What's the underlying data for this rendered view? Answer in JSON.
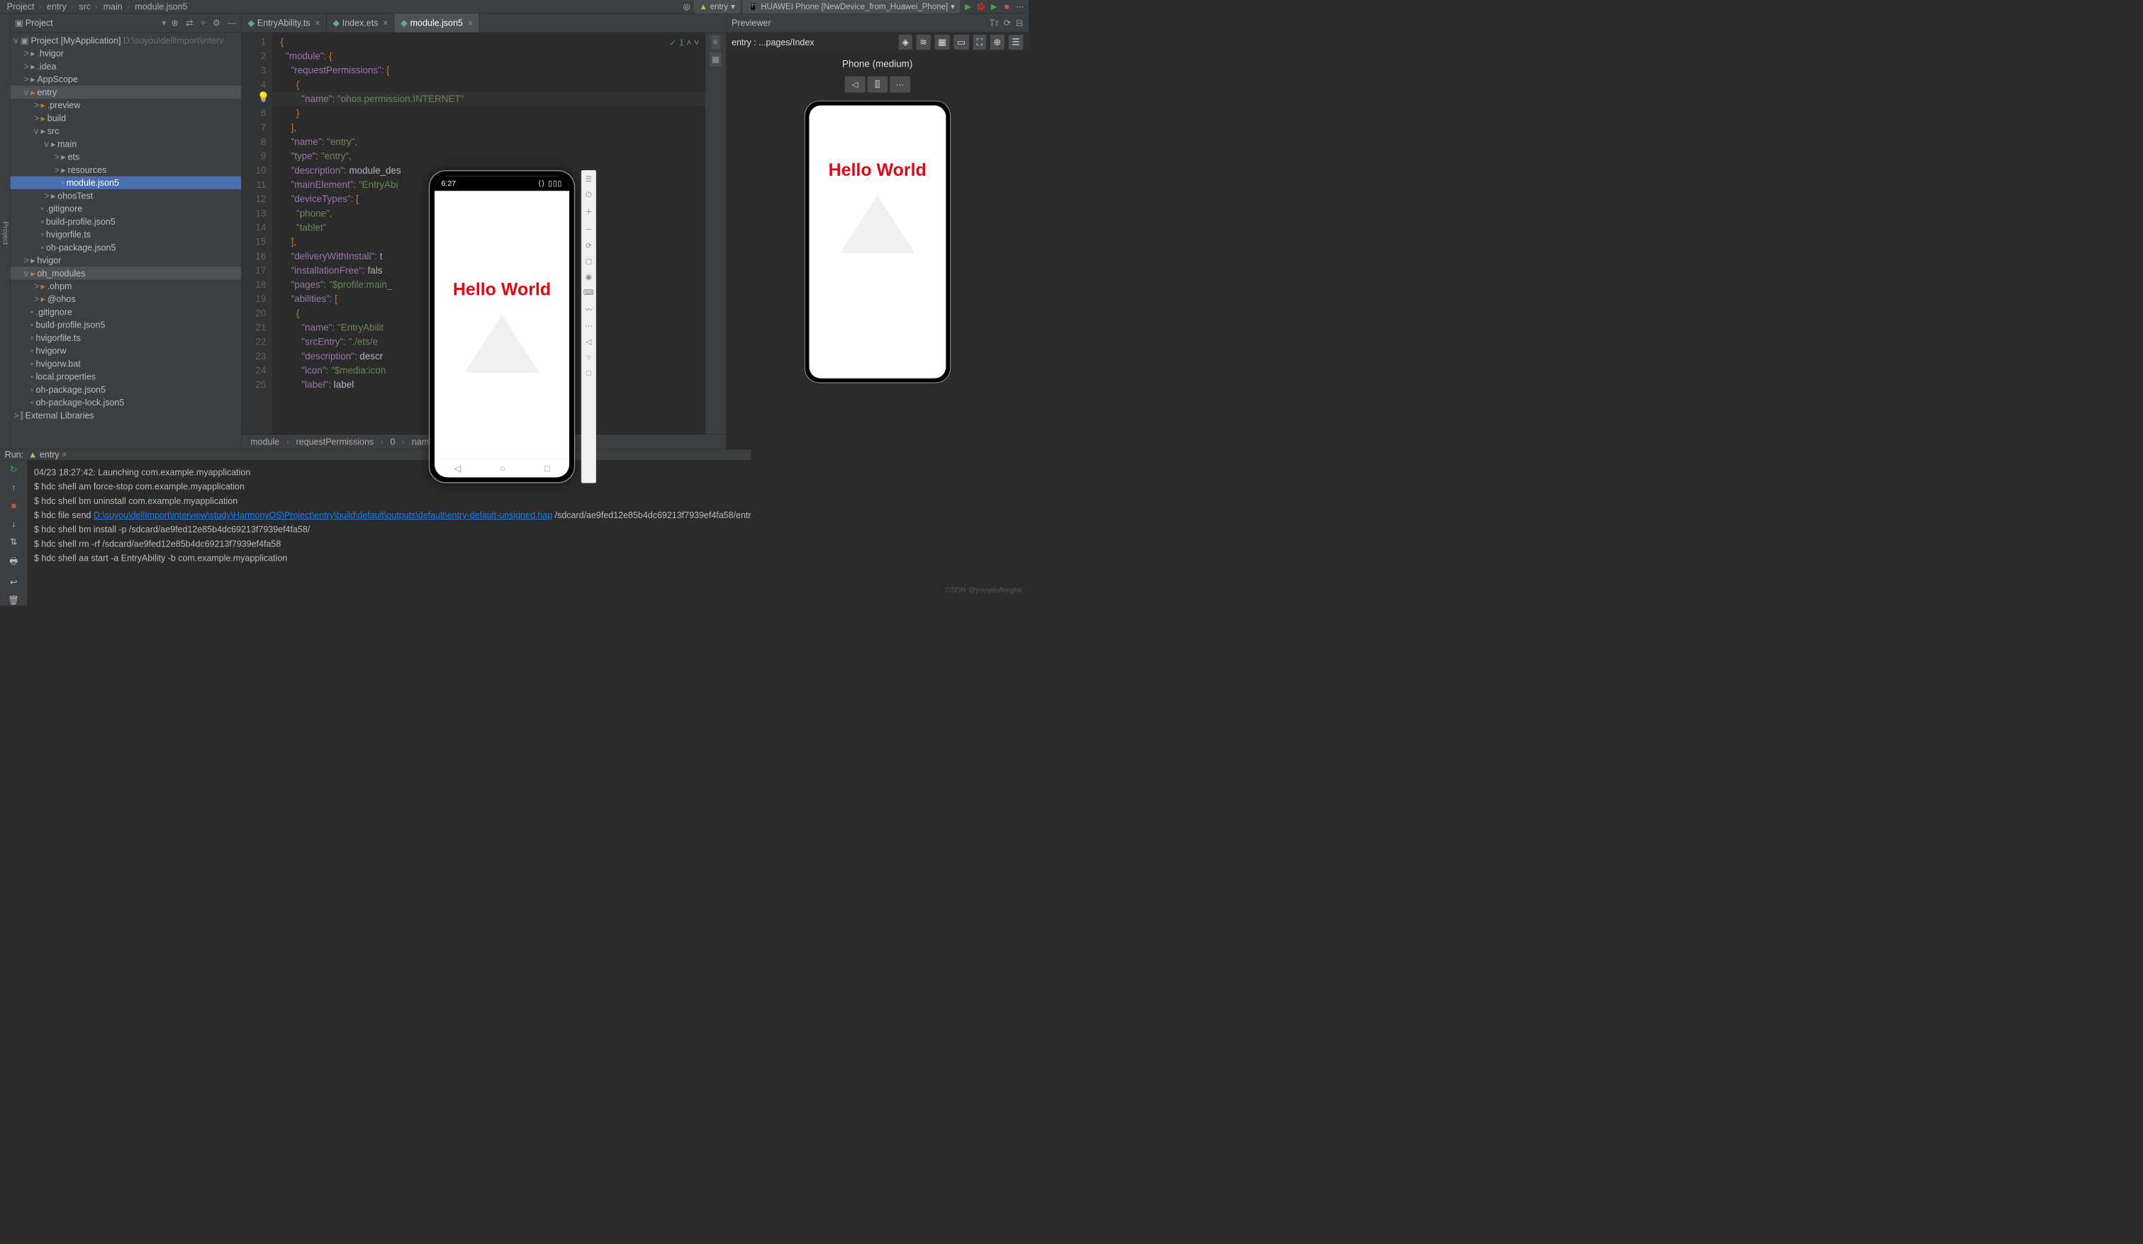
{
  "navbar": {
    "crumbs": [
      "Project",
      "entry",
      "src",
      "main",
      "module.json5"
    ],
    "run_config": "entry",
    "device": "HUAWEI Phone [NewDevice_from_Huawei_Phone]"
  },
  "project_panel": {
    "title": "Project",
    "root": "Project [MyApplication]",
    "root_path": "D:\\suyou\\dellImport\\interv",
    "tree": [
      {
        "l": 1,
        "arrow": ">",
        "icon": "folder-grey",
        "name": ".hvigor"
      },
      {
        "l": 1,
        "arrow": ">",
        "icon": "folder-grey",
        "name": ".idea"
      },
      {
        "l": 1,
        "arrow": ">",
        "icon": "folder-grey",
        "name": "AppScope"
      },
      {
        "l": 1,
        "arrow": "v",
        "icon": "folder",
        "name": "entry",
        "hl": true
      },
      {
        "l": 2,
        "arrow": ">",
        "icon": "folder",
        "name": ".preview"
      },
      {
        "l": 2,
        "arrow": ">",
        "icon": "folder",
        "name": "build"
      },
      {
        "l": 2,
        "arrow": "v",
        "icon": "folder-grey",
        "name": "src"
      },
      {
        "l": 3,
        "arrow": "v",
        "icon": "folder-grey",
        "name": "main"
      },
      {
        "l": 4,
        "arrow": ">",
        "icon": "folder-grey",
        "name": "ets"
      },
      {
        "l": 4,
        "arrow": ">",
        "icon": "folder-grey",
        "name": "resources"
      },
      {
        "l": 4,
        "arrow": "",
        "icon": "file",
        "name": "module.json5",
        "sel": true
      },
      {
        "l": 3,
        "arrow": ">",
        "icon": "folder-grey",
        "name": "ohosTest"
      },
      {
        "l": 2,
        "arrow": "",
        "icon": "file",
        "name": ".gitignore"
      },
      {
        "l": 2,
        "arrow": "",
        "icon": "file",
        "name": "build-profile.json5"
      },
      {
        "l": 2,
        "arrow": "",
        "icon": "file",
        "name": "hvigorfile.ts"
      },
      {
        "l": 2,
        "arrow": "",
        "icon": "file",
        "name": "oh-package.json5"
      },
      {
        "l": 1,
        "arrow": ">",
        "icon": "folder-grey",
        "name": "hvigor"
      },
      {
        "l": 1,
        "arrow": "v",
        "icon": "folder",
        "name": "oh_modules",
        "hl": true
      },
      {
        "l": 2,
        "arrow": ">",
        "icon": "folder",
        "name": ".ohpm"
      },
      {
        "l": 2,
        "arrow": ">",
        "icon": "folder",
        "name": "@ohos"
      },
      {
        "l": 1,
        "arrow": "",
        "icon": "file",
        "name": ".gitignore"
      },
      {
        "l": 1,
        "arrow": "",
        "icon": "file",
        "name": "build-profile.json5"
      },
      {
        "l": 1,
        "arrow": "",
        "icon": "file",
        "name": "hvigorfile.ts"
      },
      {
        "l": 1,
        "arrow": "",
        "icon": "file",
        "name": "hvigorw"
      },
      {
        "l": 1,
        "arrow": "",
        "icon": "file",
        "name": "hvigorw.bat"
      },
      {
        "l": 1,
        "arrow": "",
        "icon": "file",
        "name": "local.properties"
      },
      {
        "l": 1,
        "arrow": "",
        "icon": "file",
        "name": "oh-package.json5"
      },
      {
        "l": 1,
        "arrow": "",
        "icon": "file",
        "name": "oh-package-lock.json5"
      },
      {
        "l": 0,
        "arrow": ">",
        "icon": "lib",
        "name": "External Libraries"
      }
    ]
  },
  "editor": {
    "tabs": [
      {
        "name": "EntryAbility.ts",
        "icon": "ts"
      },
      {
        "name": "Index.ets",
        "icon": "ets"
      },
      {
        "name": "module.json5",
        "icon": "json",
        "active": true
      }
    ],
    "status": "✓ 1",
    "lines": [
      [
        [
          "pun",
          "{"
        ]
      ],
      [
        [
          "plain",
          "  "
        ],
        [
          "key",
          "\"module\""
        ],
        [
          "pun",
          ": {"
        ]
      ],
      [
        [
          "plain",
          "    "
        ],
        [
          "key",
          "\"requestPermissions\""
        ],
        [
          "pun",
          ": ["
        ]
      ],
      [
        [
          "plain",
          "      "
        ],
        [
          "pun",
          "{"
        ]
      ],
      [
        [
          "plain",
          "        "
        ],
        [
          "key",
          "\"name\""
        ],
        [
          "pun",
          ": "
        ],
        [
          "str",
          "\"ohos.permission.INTERNET\""
        ]
      ],
      [
        [
          "plain",
          "      "
        ],
        [
          "pun",
          "}"
        ]
      ],
      [
        [
          "plain",
          "    "
        ],
        [
          "pun",
          "],"
        ]
      ],
      [
        [
          "plain",
          "    "
        ],
        [
          "key",
          "\"name\""
        ],
        [
          "pun",
          ": "
        ],
        [
          "str",
          "\"entry\""
        ],
        [
          "pun",
          ","
        ]
      ],
      [
        [
          "plain",
          "    "
        ],
        [
          "key",
          "\"type\""
        ],
        [
          "pun",
          ": "
        ],
        [
          "str",
          "\"entry\""
        ],
        [
          "pun",
          ","
        ]
      ],
      [
        [
          "plain",
          "    "
        ],
        [
          "key",
          "\"description\""
        ],
        [
          "pun",
          ": "
        ],
        [
          "plain",
          "module_des"
        ]
      ],
      [
        [
          "plain",
          "    "
        ],
        [
          "key",
          "\"mainElement\""
        ],
        [
          "pun",
          ": "
        ],
        [
          "str",
          "\"EntryAbi"
        ]
      ],
      [
        [
          "plain",
          "    "
        ],
        [
          "key",
          "\"deviceTypes\""
        ],
        [
          "pun",
          ": ["
        ]
      ],
      [
        [
          "plain",
          "      "
        ],
        [
          "str",
          "\"phone\""
        ],
        [
          "pun",
          ","
        ]
      ],
      [
        [
          "plain",
          "      "
        ],
        [
          "str",
          "\"tablet\""
        ]
      ],
      [
        [
          "plain",
          "    "
        ],
        [
          "pun",
          "],"
        ]
      ],
      [
        [
          "plain",
          "    "
        ],
        [
          "key",
          "\"deliveryWithInstall\""
        ],
        [
          "pun",
          ": "
        ],
        [
          "plain",
          "t"
        ]
      ],
      [
        [
          "plain",
          "    "
        ],
        [
          "key",
          "\"installationFree\""
        ],
        [
          "pun",
          ": "
        ],
        [
          "plain",
          "fals"
        ]
      ],
      [
        [
          "plain",
          "    "
        ],
        [
          "key",
          "\"pages\""
        ],
        [
          "pun",
          ": "
        ],
        [
          "str",
          "\"$profile:main_"
        ]
      ],
      [
        [
          "plain",
          "    "
        ],
        [
          "key",
          "\"abilities\""
        ],
        [
          "pun",
          ": ["
        ]
      ],
      [
        [
          "plain",
          "      "
        ],
        [
          "pun",
          "{"
        ]
      ],
      [
        [
          "plain",
          "        "
        ],
        [
          "key",
          "\"name\""
        ],
        [
          "pun",
          ": "
        ],
        [
          "str",
          "\"EntryAbilit"
        ]
      ],
      [
        [
          "plain",
          "        "
        ],
        [
          "key",
          "\"srcEntry\""
        ],
        [
          "pun",
          ": "
        ],
        [
          "str",
          "\"./ets/e"
        ]
      ],
      [
        [
          "plain",
          "        "
        ],
        [
          "key",
          "\"description\""
        ],
        [
          "pun",
          ": "
        ],
        [
          "plain",
          "descr"
        ]
      ],
      [
        [
          "plain",
          "        "
        ],
        [
          "key",
          "\"icon\""
        ],
        [
          "pun",
          ": "
        ],
        [
          "str",
          "\"$media:icon"
        ]
      ],
      [
        [
          "plain",
          "        "
        ],
        [
          "key",
          "\"label\""
        ],
        [
          "pun",
          ": "
        ],
        [
          "plain",
          "label"
        ]
      ]
    ],
    "highlight_line": 5,
    "breadcrumb": [
      "module",
      "requestPermissions",
      "0",
      "name"
    ]
  },
  "previewer": {
    "title": "Previewer",
    "entry": "entry : ...pages/Index",
    "device_label": "Phone (medium)",
    "hello": "Hello World"
  },
  "emulator": {
    "time": "6:27",
    "status_icons": "⟨⟩ ▯▯▯",
    "hello": "Hello World"
  },
  "run": {
    "label": "Run:",
    "tab": "entry",
    "lines": [
      {
        "t": "04/23 18:27:42: Launching com.example.myapplication"
      },
      {
        "t": "$ hdc shell am force-stop com.example.myapplication"
      },
      {
        "t": "$ hdc shell bm uninstall com.example.myapplication"
      },
      {
        "p": "$ hdc file send ",
        "link": "D:\\suyou\\dellImport\\interview\\study\\HarmonyOS\\Project\\entry\\build\\default\\outputs\\default\\entry-default-unsigned.hap",
        "s": " /sdcard/ae9fed12e85b4dc69213f7939ef4fa58/entr"
      },
      {
        "t": "$ hdc shell bm install -p /sdcard/ae9fed12e85b4dc69213f7939ef4fa58/"
      },
      {
        "t": "$ hdc shell rm -rf /sdcard/ae9fed12e85b4dc69213f7939ef4fa58"
      },
      {
        "t": "$ hdc shell aa start -a EntryAbility -b com.example.myapplication"
      }
    ]
  },
  "watermark": "CSDN @youyoufenglai"
}
